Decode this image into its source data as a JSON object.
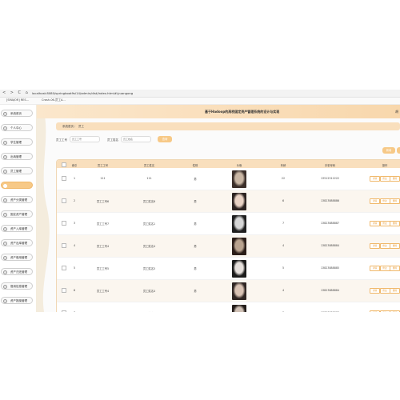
{
  "browser": {
    "nav": "< > C ⌂",
    "url": "localhost:8080/springboot9si14/admin/dist/index.html#/yuangong",
    "bookmarks": [
      "[SMAJOR] RES...",
      "Crash-06-员工A..."
    ]
  },
  "header": {
    "title": "基于Hadoop的高校固定资产管理系统的设计与实现",
    "right": "胡"
  },
  "sidebar": {
    "items": [
      {
        "label": "系统首页",
        "active": false
      },
      {
        "label": "个人中心",
        "active": false
      },
      {
        "label": "学生管理",
        "active": false
      },
      {
        "label": "出纳管理",
        "active": false
      },
      {
        "label": "员工管理",
        "active": false
      },
      {
        "label": "",
        "active": true
      },
      {
        "label": "资产分类管理",
        "active": false
      },
      {
        "label": "固定资产管理",
        "active": false
      },
      {
        "label": "资产入库管理",
        "active": false
      },
      {
        "label": "资产出库管理",
        "active": false
      },
      {
        "label": "资产借用管理",
        "active": false
      },
      {
        "label": "资产归还管理",
        "active": false
      },
      {
        "label": "借用信息管理",
        "active": false
      },
      {
        "label": "资产报废管理",
        "active": false
      }
    ]
  },
  "breadcrumb": {
    "home": "系统首页",
    "current": "员工"
  },
  "search": {
    "field1_label": "员工工号",
    "field1_placeholder": "员工工号",
    "field2_label": "员工姓名",
    "field2_placeholder": "员工姓名",
    "button": "查询"
  },
  "actions": {
    "add": "新增"
  },
  "table": {
    "headers": [
      "索引",
      "员工工号",
      "员工姓名",
      "性别",
      "头像",
      "年龄",
      "手机号码",
      "操作"
    ],
    "rows": [
      {
        "index": "1",
        "id": "111",
        "name": "111",
        "gender": "男",
        "age": "22",
        "phone": "13512512222"
      },
      {
        "index": "2",
        "id": "员工工号6",
        "name": "员工姓名6",
        "gender": "男",
        "age": "6",
        "phone": "13823888886"
      },
      {
        "index": "3",
        "id": "员工工号7",
        "name": "员工姓名1",
        "gender": "男",
        "age": "7",
        "phone": "13823888887"
      },
      {
        "index": "4",
        "id": "员工工号4",
        "name": "员工姓名4",
        "gender": "男",
        "age": "4",
        "phone": "13823888884"
      },
      {
        "index": "5",
        "id": "员工工号5",
        "name": "员工姓名5",
        "gender": "男",
        "age": "5",
        "phone": "13823888885"
      },
      {
        "index": "6",
        "id": "员工工号4",
        "name": "员工姓名4",
        "gender": "男",
        "age": "4",
        "phone": "13823888884"
      },
      {
        "index": "7",
        "id": "员工工号3",
        "name": "员工姓名3",
        "gender": "男",
        "age": "3",
        "phone": "13823888883"
      }
    ],
    "row_actions": [
      "详情",
      "修改",
      "删除"
    ]
  },
  "colors": {
    "accent": "#f7c987",
    "header_bg": "#f9dfbd"
  }
}
